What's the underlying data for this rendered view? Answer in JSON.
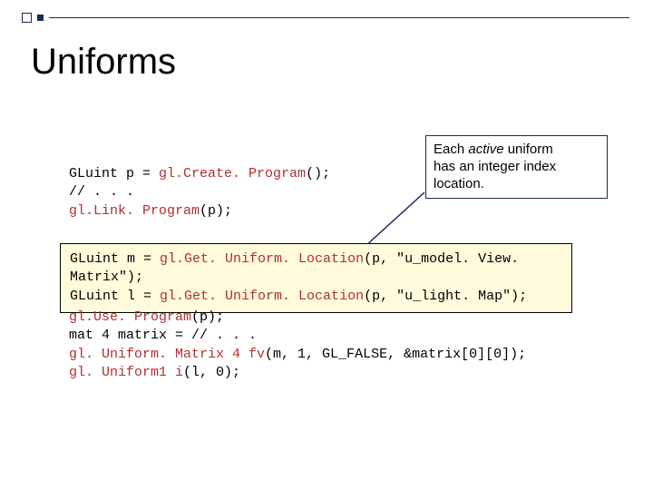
{
  "title": "Uniforms",
  "callout": {
    "line1_pre": "Each ",
    "line1_em": "active",
    "line1_post": " uniform",
    "line2": "has an integer index",
    "line3": "location."
  },
  "code1": {
    "l1a": "GLuint p = ",
    "l1b": "gl.Create. Program",
    "l1c": "();",
    "l2": "// . . .",
    "l3a": "gl.Link. Program",
    "l3b": "(p);"
  },
  "code2": {
    "l1a": "GLuint m = ",
    "l1b": "gl.Get. Uniform. Location",
    "l1c": "(p, \"u_model. View. Matrix\");",
    "l2a": "GLuint l = ",
    "l2b": "gl.Get. Uniform. Location",
    "l2c": "(p, \"u_light. Map\");"
  },
  "code3": {
    "l1a": "gl.Use. Program",
    "l1b": "(p);",
    "l2": "mat 4 matrix = // . . .",
    "l3a": "gl. Uniform. Matrix 4 fv",
    "l3b": "(m, 1, GL_FALSE, &matrix[0][0]);",
    "l4a": "gl. Uniform1 i",
    "l4b": "(l, 0);"
  }
}
